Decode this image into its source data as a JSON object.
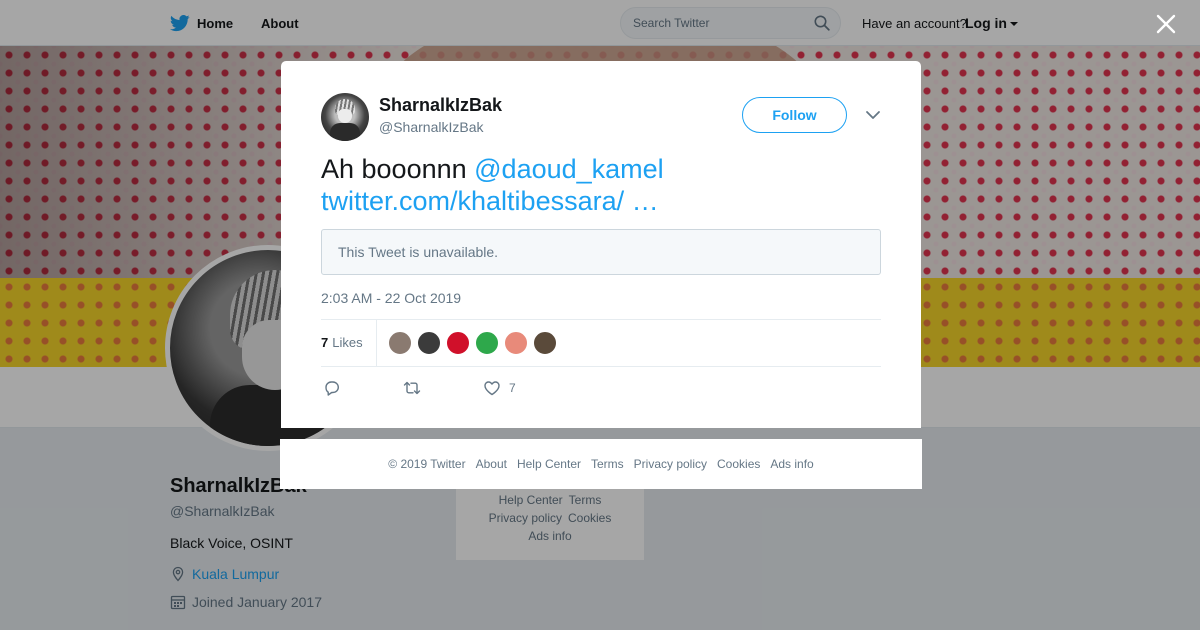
{
  "nav": {
    "home_label": "Home",
    "about_label": "About",
    "search_placeholder": "Search Twitter",
    "have_account": "Have an account?",
    "login_label": "Log in"
  },
  "profile": {
    "name": "SharnalkIzBak",
    "handle": "@SharnalkIzBak",
    "bio": "Black Voice, OSINT",
    "location": "Kuala Lumpur",
    "joined": "Joined January 2017"
  },
  "side_footer": {
    "links": [
      "Help Center",
      "Terms",
      "Privacy policy",
      "Cookies",
      "Ads info"
    ]
  },
  "tweet": {
    "author_name": "SharnalkIzBak",
    "author_handle": "@SharnalkIzBak",
    "follow_label": "Follow",
    "text_prefix": "Ah booonnn ",
    "mention": "@daoud_kamel",
    "link": "twitter.com/khaltibessara/ …",
    "quote_unavailable": "This Tweet is unavailable.",
    "timestamp": "2:03 AM - 22 Oct 2019",
    "likes_count": "7",
    "likes_label": "Likes",
    "like_action_count": "7",
    "liker_colors": [
      "#8a7a70",
      "#3b3b3b",
      "#d0102a",
      "#2ea84b",
      "#e88a7a",
      "#5a4a3a"
    ]
  },
  "footer": {
    "copyright": "© 2019 Twitter",
    "links": [
      "About",
      "Help Center",
      "Terms",
      "Privacy policy",
      "Cookies",
      "Ads info"
    ]
  },
  "colors": {
    "brand": "#1da1f2",
    "text_secondary": "#657786"
  }
}
